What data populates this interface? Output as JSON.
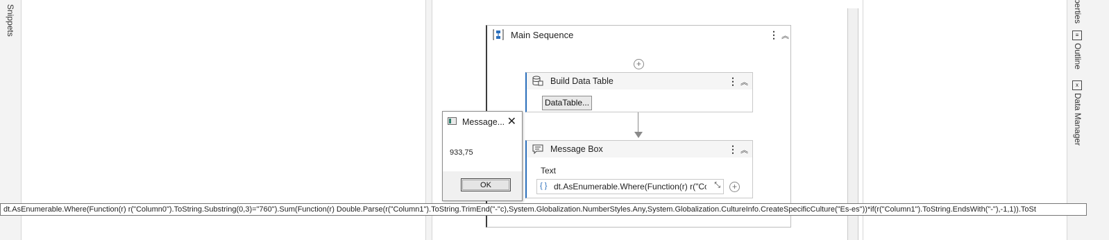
{
  "left_panel": {
    "snippets_label": "Snippets"
  },
  "right_panel": {
    "properties_label": "perties",
    "outline_label": "Outline",
    "data_manager_label": "Data Manager"
  },
  "designer": {
    "sequence": {
      "title": "Main Sequence"
    },
    "build_data_table": {
      "title": "Build Data Table",
      "button_label": "DataTable..."
    },
    "message_box": {
      "title": "Message Box",
      "text_label": "Text",
      "expression": "dt.AsEnumerable.Where(Function(r) r(\"Colu"
    }
  },
  "dialog": {
    "title": "Message...",
    "value": "933,75",
    "ok_label": "OK"
  },
  "tooltip": {
    "text": "dt.AsEnumerable.Where(Function(r) r(\"Column0\").ToString.Substring(0,3)=\"760\").Sum(Function(r) Double.Parse(r(\"Column1\").ToString.TrimEnd(\"-\"c),System.Globalization.NumberStyles.Any,System.Globalization.CultureInfo.CreateSpecificCulture(\"Es-es\"))*if(r(\"Column1\").ToString.EndsWith(\"-\"),-1,1)).ToSt"
  },
  "icons": [
    "sequence-icon",
    "data-table-icon",
    "message-icon",
    "kebab-icon",
    "collapse-icon",
    "add-circle-icon",
    "close-icon",
    "expand-icon",
    "outline-icon",
    "data-manager-icon"
  ],
  "colors": {
    "accent": "#2a6ebb",
    "panel_bg": "#f3f3f3"
  }
}
